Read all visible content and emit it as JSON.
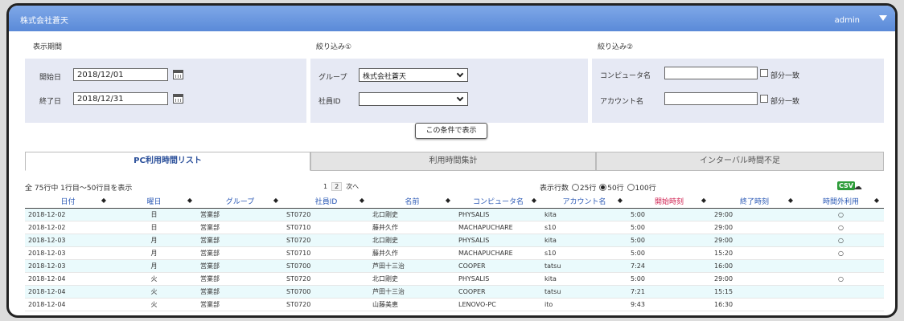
{
  "header": {
    "company": "株式会社蒼天",
    "user": "admin"
  },
  "filters": {
    "period": {
      "title": "表示期間",
      "start_label": "開始日",
      "start_value": "2018/12/01",
      "end_label": "終了日",
      "end_value": "2018/12/31"
    },
    "narrow1": {
      "title": "絞り込み①",
      "group_label": "グループ",
      "group_value": "株式会社蒼天",
      "employee_label": "社員ID",
      "employee_value": ""
    },
    "narrow2": {
      "title": "絞り込み②",
      "computer_label": "コンピュータ名",
      "computer_value": "",
      "computer_partial": "部分一致",
      "account_label": "アカウント名",
      "account_value": "",
      "account_partial": "部分一致"
    },
    "show_button": "この条件で表示"
  },
  "tabs": [
    {
      "label": "PC利用時間リスト",
      "active": true
    },
    {
      "label": "利用時間集計",
      "active": false
    },
    {
      "label": "インターバル時間不足",
      "active": false
    }
  ],
  "list_info": {
    "summary": "全 75行中 1行目～50行目を表示",
    "pages": [
      "1",
      "2"
    ],
    "next": "次へ",
    "rows_label": "表示行数",
    "rows_options": [
      "25行",
      "50行",
      "100行"
    ],
    "rows_selected": "50行",
    "csv_label": "CSV",
    "csv_color": "#2e9c3a"
  },
  "table": {
    "columns": [
      "日付",
      "曜日",
      "グループ",
      "社員ID",
      "名前",
      "コンピュータ名",
      "アカウント名",
      "開始時刻",
      "終了時刻",
      "時間外利用"
    ],
    "rows": [
      [
        "2018-12-02",
        "日",
        "営業部",
        "ST0720",
        "北口剛史",
        "PHYSALIS",
        "kita",
        "5:00",
        "29:00",
        "○"
      ],
      [
        "2018-12-02",
        "日",
        "営業部",
        "ST0710",
        "藤井久作",
        "MACHAPUCHARE",
        "s10",
        "5:00",
        "29:00",
        "○"
      ],
      [
        "2018-12-03",
        "月",
        "営業部",
        "ST0720",
        "北口剛史",
        "PHYSALIS",
        "kita",
        "5:00",
        "29:00",
        "○"
      ],
      [
        "2018-12-03",
        "月",
        "営業部",
        "ST0710",
        "藤井久作",
        "MACHAPUCHARE",
        "s10",
        "5:00",
        "15:20",
        "○"
      ],
      [
        "2018-12-03",
        "月",
        "営業部",
        "ST0700",
        "芦田十三治",
        "COOPER",
        "tatsu",
        "7:24",
        "16:00",
        ""
      ],
      [
        "2018-12-04",
        "火",
        "営業部",
        "ST0720",
        "北口剛史",
        "PHYSALIS",
        "kita",
        "5:00",
        "29:00",
        "○"
      ],
      [
        "2018-12-04",
        "火",
        "営業部",
        "ST0700",
        "芦田十三治",
        "COOPER",
        "tatsu",
        "7:21",
        "15:15",
        ""
      ],
      [
        "2018-12-04",
        "火",
        "営業部",
        "ST0720",
        "山藤美恵",
        "LENOVO-PC",
        "ito",
        "9:43",
        "16:30",
        ""
      ]
    ]
  }
}
